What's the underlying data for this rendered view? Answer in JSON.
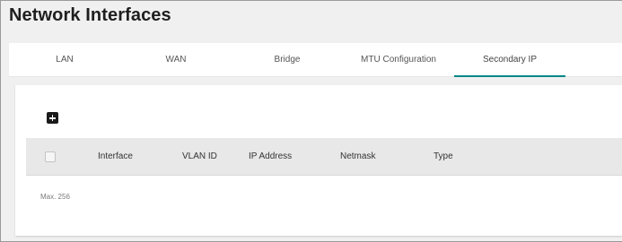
{
  "page": {
    "title": "Network Interfaces"
  },
  "tabs": [
    {
      "label": "LAN",
      "active": false
    },
    {
      "label": "WAN",
      "active": false
    },
    {
      "label": "Bridge",
      "active": false
    },
    {
      "label": "MTU Configuration",
      "active": false
    },
    {
      "label": "Secondary IP",
      "active": true
    }
  ],
  "toolbar": {
    "add_icon": "plus-square-icon"
  },
  "table": {
    "columns": [
      "Interface",
      "VLAN ID",
      "IP Address",
      "Netmask",
      "Type"
    ],
    "rows": [],
    "footer_text": "Max. 256"
  },
  "colors": {
    "accent": "#008787",
    "header_bg": "#e8e8e8",
    "page_bg": "#f0f0f0"
  }
}
